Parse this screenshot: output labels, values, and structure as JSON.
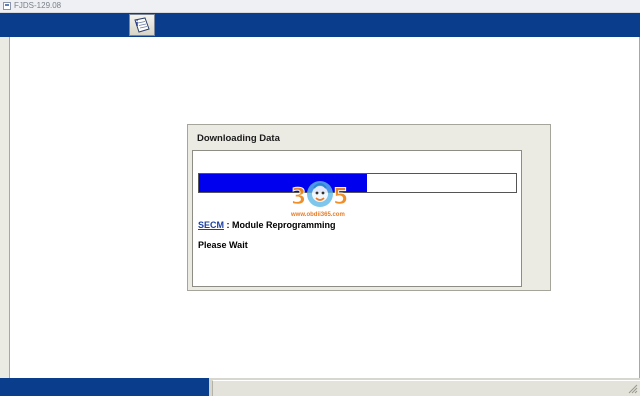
{
  "window": {
    "title": "FJDS-129.08"
  },
  "toolbar": {
    "buttons": [
      {
        "icon": "info-document-icon"
      }
    ]
  },
  "dialog": {
    "title": "Downloading Data",
    "progress_fraction": 0.53,
    "module_link": "SECM",
    "module_text": " : Module Reprogramming",
    "wait_text": "Please Wait"
  },
  "watermark": {
    "url": "www.obdii365.com"
  },
  "colors": {
    "toolbar_blue": "#0a3e8c",
    "progress_blue": "#0000ee",
    "link_blue": "#1b3ea3",
    "dialog_gray": "#ecebe3"
  }
}
